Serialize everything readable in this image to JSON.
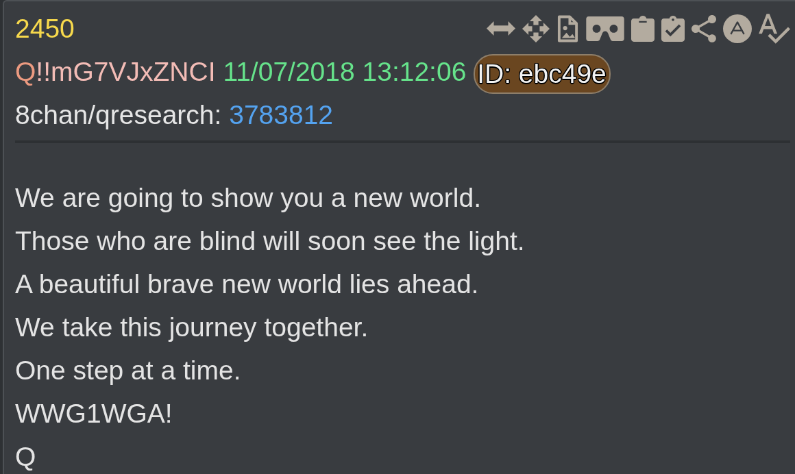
{
  "post": {
    "number": "2450",
    "author": {
      "name": "Q",
      "tripcode": "!!mG7VJxZNCI"
    },
    "timestamp": "11/07/2018 13:12:06",
    "poster_id": "ID: ebc49e",
    "source": {
      "board": "8chan/qresearch:",
      "thread": "3783812"
    },
    "body": [
      "We are going to show you a new world.",
      "Those who are blind will soon see the light.",
      "A beautiful brave new world lies ahead.",
      "We take this journey together.",
      "One step at a time.",
      "WWG1WGA!",
      "Q"
    ]
  }
}
